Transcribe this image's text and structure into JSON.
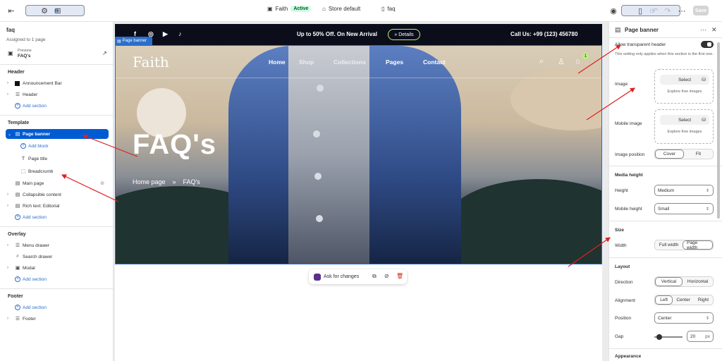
{
  "topbar": {
    "theme_name": "Faith",
    "theme_status": "Active",
    "store": "Store default",
    "page": "faq",
    "save_label": "Save"
  },
  "left_panel": {
    "title": "faq",
    "assigned": "Assigned to 1 page",
    "preview_label": "Preview",
    "preview_value": "FAQ's",
    "header_group": "Header",
    "header_items": [
      "Announcement Bar",
      "Header"
    ],
    "add_section": "Add section",
    "template_group": "Template",
    "template_active": "Page banner",
    "add_block": "Add block",
    "blocks": [
      "Page title",
      "Breadcrumb"
    ],
    "template_items": [
      "Main page",
      "Collapsible content",
      "Rich text: Editorial"
    ],
    "overlay_group": "Overlay",
    "overlay_items": [
      "Menu drawer",
      "Search drawer",
      "Modal"
    ],
    "footer_group": "Footer",
    "footer_items": [
      "Footer"
    ]
  },
  "canvas": {
    "section_label": "Page banner",
    "announcement": {
      "promo": "Up to 50% Off. On New Arrival",
      "details": "» Details",
      "call": "Call Us: +99 (123) 456780"
    },
    "nav": {
      "logo": "Faith",
      "items": [
        "Home",
        "Shop",
        "Collections",
        "Pages",
        "Contact"
      ],
      "cart_count": "1"
    },
    "banner_title": "FAQ's",
    "breadcrumb": [
      "Home page",
      "»",
      "FAQ's"
    ],
    "ask": "Ask for changes"
  },
  "right_panel": {
    "title": "Page banner",
    "transparent_label": "Allow transparent header",
    "transparent_note": "This setting only applies when this section is the first one.",
    "image_label": "Image",
    "mobile_image_label": "Mobile image",
    "select": "Select",
    "explore": "Explore free images",
    "image_position_label": "Image position",
    "image_position_options": [
      "Cover",
      "Fit"
    ],
    "media_height_heading": "Media height",
    "height_label": "Height",
    "height_value": "Medium",
    "mobile_height_label": "Mobile height",
    "mobile_height_value": "Small",
    "size_heading": "Size",
    "width_label": "Width",
    "width_options": [
      "Full width",
      "Page width"
    ],
    "layout_heading": "Layout",
    "direction_label": "Direction",
    "direction_options": [
      "Vertical",
      "Horizontal"
    ],
    "alignment_label": "Alignment",
    "alignment_options": [
      "Left",
      "Center",
      "Right"
    ],
    "position_label": "Position",
    "position_value": "Center",
    "gap_label": "Gap",
    "gap_value": "20",
    "gap_unit": "px",
    "appearance_heading": "Appearance"
  },
  "colors": {
    "accent": "#005bd3",
    "annotation": "#e02020",
    "lime": "#b9f27b"
  }
}
